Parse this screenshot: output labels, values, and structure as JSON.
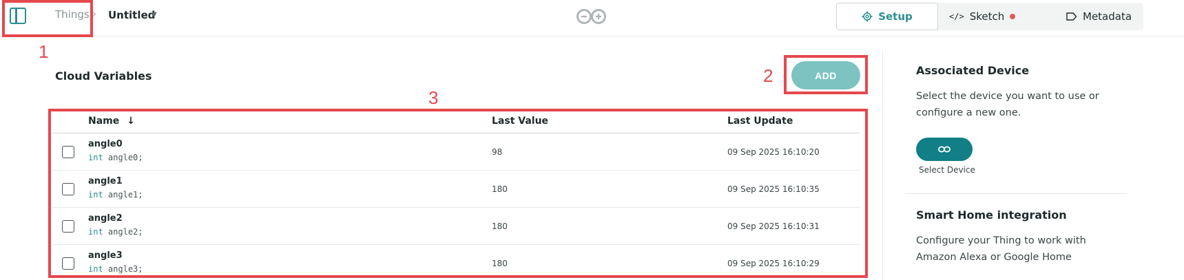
{
  "header": {
    "breadcrumb_root": "Things",
    "breadcrumb_separator": "›",
    "thing_name": "Untitled",
    "tabs": [
      {
        "label": "Setup",
        "icon": "gear-icon",
        "active": true
      },
      {
        "label": "Sketch",
        "icon": "code-icon",
        "active": false,
        "status_dot_color": "#dd5a5a"
      },
      {
        "label": "Metadata",
        "icon": "tag-icon",
        "active": false
      }
    ]
  },
  "main": {
    "title": "Cloud Variables",
    "add_label": "ADD",
    "columns": {
      "name": "Name",
      "last_value": "Last Value",
      "last_update": "Last Update"
    },
    "rows": [
      {
        "name": "angle0",
        "type": "int",
        "decl": "angle0;",
        "value": "98",
        "updated": "09 Sep 2025 16:10:20"
      },
      {
        "name": "angle1",
        "type": "int",
        "decl": "angle1;",
        "value": "180",
        "updated": "09 Sep 2025 16:10:35"
      },
      {
        "name": "angle2",
        "type": "int",
        "decl": "angle2;",
        "value": "180",
        "updated": "09 Sep 2025 16:10:31"
      },
      {
        "name": "angle3",
        "type": "int",
        "decl": "angle3;",
        "value": "180",
        "updated": "09 Sep 2025 16:10:29"
      }
    ]
  },
  "right_panel": {
    "device_title": "Associated Device",
    "device_text": "Select the device you want to use or configure a new one.",
    "select_device_label": "Select Device",
    "smart_home_title": "Smart Home integration",
    "smart_home_text": "Configure your Thing to work with Amazon Alexa or Google Home"
  },
  "annotations": [
    "1",
    "2",
    "3"
  ],
  "colors": {
    "accent": "#2a8f93",
    "add_button": "#7cc3c2",
    "device_button": "#117f85",
    "annotation": "#e5484d"
  }
}
